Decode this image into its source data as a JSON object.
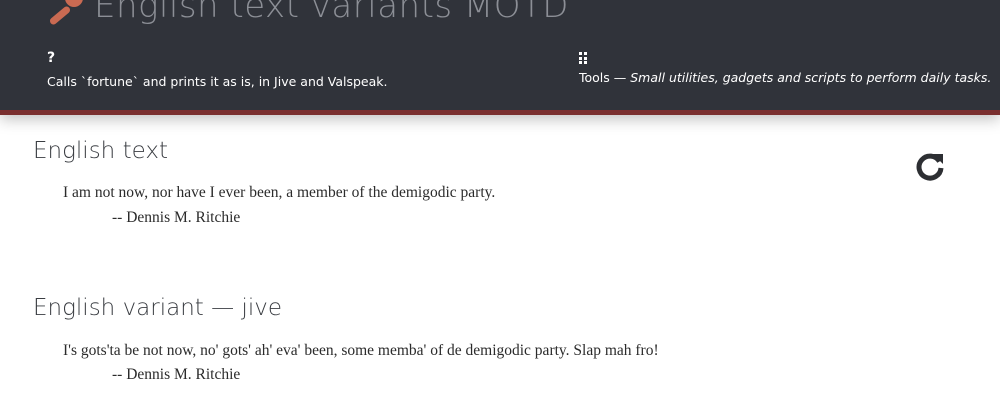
{
  "header": {
    "title": "English text variants MOTD",
    "title_icon": "wrench-icon",
    "about": {
      "icon_glyph": "?",
      "text": "Calls `fortune` and prints it as is, in Jive and Valspeak."
    },
    "category": {
      "icon": "grid-icon",
      "name": "Tools",
      "separator": " — ",
      "description": "Small utilities, gadgets and scripts to perform daily tasks."
    },
    "accent_color": "#7a2f2f",
    "background_color": "#30333a"
  },
  "actions": {
    "refresh_icon": "refresh-icon"
  },
  "sections": [
    {
      "heading": "English text",
      "quote": "I am not now, nor have I ever been, a member of the demigodic party.",
      "attribution": "-- Dennis M. Ritchie"
    },
    {
      "heading": "English variant — jive",
      "quote": "I's gots'ta be not now, no' gots' ah' eva' been, some memba' of de demigodic party.  Slap mah fro!",
      "attribution": "-- Dennis M. Ritchie"
    }
  ]
}
